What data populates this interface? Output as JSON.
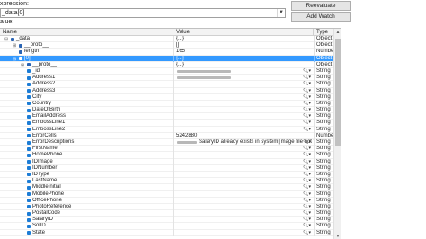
{
  "expression": {
    "label": "xpression:",
    "value": "_data[0]"
  },
  "buttons": {
    "reevaluate": "Reevaluate",
    "add_watch": "Add Watch"
  },
  "value_label": "alue:",
  "columns": {
    "name": "Name",
    "value": "Value",
    "type": "Type"
  },
  "rows": [
    {
      "name": "_data",
      "value": "{...}",
      "type": "Object, {",
      "level": 0,
      "toggle": "⊟",
      "icon": "bl",
      "selected": false,
      "magnifier": false,
      "redacted": false
    },
    {
      "name": "__proto__",
      "value": "[]",
      "type": "Object, [",
      "level": 1,
      "toggle": "⊞",
      "icon": "bl",
      "selected": false,
      "magnifier": false,
      "redacted": false
    },
    {
      "name": "length",
      "value": "165",
      "type": "Number",
      "level": 1,
      "toggle": "",
      "icon": "bl",
      "selected": false,
      "magnifier": false,
      "redacted": false
    },
    {
      "name": "[0]",
      "value": "{...}",
      "type": "Object",
      "level": 1,
      "toggle": "⊟",
      "icon": "bl",
      "selected": true,
      "magnifier": false,
      "redacted": false
    },
    {
      "name": "__proto__",
      "value": "{...}",
      "type": "Object",
      "level": 2,
      "toggle": "⊞",
      "icon": "bl",
      "selected": false,
      "magnifier": false,
      "redacted": false
    },
    {
      "name": "_id",
      "value": "",
      "type": "String",
      "level": 2,
      "toggle": "",
      "icon": "",
      "selected": false,
      "magnifier": true,
      "redacted": true
    },
    {
      "name": "Address1",
      "value": "",
      "type": "String",
      "level": 2,
      "toggle": "",
      "icon": "",
      "selected": false,
      "magnifier": true,
      "redacted": true
    },
    {
      "name": "Address2",
      "value": "",
      "type": "String",
      "level": 2,
      "toggle": "",
      "icon": "",
      "selected": false,
      "magnifier": true,
      "redacted": false
    },
    {
      "name": "Address3",
      "value": "",
      "type": "String",
      "level": 2,
      "toggle": "",
      "icon": "",
      "selected": false,
      "magnifier": true,
      "redacted": false
    },
    {
      "name": "City",
      "value": "",
      "type": "String",
      "level": 2,
      "toggle": "",
      "icon": "",
      "selected": false,
      "magnifier": true,
      "redacted": false
    },
    {
      "name": "Country",
      "value": "",
      "type": "String",
      "level": 2,
      "toggle": "",
      "icon": "",
      "selected": false,
      "magnifier": true,
      "redacted": false
    },
    {
      "name": "DateOfBirth",
      "value": "",
      "type": "String",
      "level": 2,
      "toggle": "",
      "icon": "",
      "selected": false,
      "magnifier": true,
      "redacted": false
    },
    {
      "name": "EmailAddress",
      "value": "",
      "type": "String",
      "level": 2,
      "toggle": "",
      "icon": "",
      "selected": false,
      "magnifier": true,
      "redacted": false
    },
    {
      "name": "EmbossLine1",
      "value": "",
      "type": "String",
      "level": 2,
      "toggle": "",
      "icon": "",
      "selected": false,
      "magnifier": true,
      "redacted": false
    },
    {
      "name": "EmbossLine2",
      "value": "",
      "type": "String",
      "level": 2,
      "toggle": "",
      "icon": "",
      "selected": false,
      "magnifier": true,
      "redacted": false
    },
    {
      "name": "ErrorCells",
      "value": "5242880",
      "type": "Number",
      "level": 2,
      "toggle": "",
      "icon": "",
      "selected": false,
      "magnifier": false,
      "redacted": false
    },
    {
      "name": "ErrorDescriptions",
      "value": "SalaryID already exists in system|Image file not found",
      "type": "String",
      "level": 2,
      "toggle": "",
      "icon": "",
      "selected": false,
      "magnifier": true,
      "redacted": true
    },
    {
      "name": "FirstName",
      "value": "",
      "type": "String",
      "level": 2,
      "toggle": "",
      "icon": "",
      "selected": false,
      "magnifier": true,
      "redacted": false
    },
    {
      "name": "HomePhone",
      "value": "",
      "type": "String",
      "level": 2,
      "toggle": "",
      "icon": "",
      "selected": false,
      "magnifier": true,
      "redacted": false
    },
    {
      "name": "IDImage",
      "value": "",
      "type": "String",
      "level": 2,
      "toggle": "",
      "icon": "",
      "selected": false,
      "magnifier": true,
      "redacted": false
    },
    {
      "name": "IDNumber",
      "value": "",
      "type": "String",
      "level": 2,
      "toggle": "",
      "icon": "",
      "selected": false,
      "magnifier": true,
      "redacted": false
    },
    {
      "name": "IDType",
      "value": "",
      "type": "String",
      "level": 2,
      "toggle": "",
      "icon": "",
      "selected": false,
      "magnifier": true,
      "redacted": false
    },
    {
      "name": "LastName",
      "value": "",
      "type": "String",
      "level": 2,
      "toggle": "",
      "icon": "",
      "selected": false,
      "magnifier": true,
      "redacted": false
    },
    {
      "name": "MiddleInitial",
      "value": "",
      "type": "String",
      "level": 2,
      "toggle": "",
      "icon": "",
      "selected": false,
      "magnifier": true,
      "redacted": false
    },
    {
      "name": "MobilePhone",
      "value": "",
      "type": "String",
      "level": 2,
      "toggle": "",
      "icon": "",
      "selected": false,
      "magnifier": true,
      "redacted": false
    },
    {
      "name": "OfficePhone",
      "value": "",
      "type": "String",
      "level": 2,
      "toggle": "",
      "icon": "",
      "selected": false,
      "magnifier": true,
      "redacted": false
    },
    {
      "name": "PhotoReference",
      "value": "",
      "type": "String",
      "level": 2,
      "toggle": "",
      "icon": "",
      "selected": false,
      "magnifier": true,
      "redacted": false
    },
    {
      "name": "PostalCode",
      "value": "",
      "type": "String",
      "level": 2,
      "toggle": "",
      "icon": "",
      "selected": false,
      "magnifier": true,
      "redacted": false
    },
    {
      "name": "SalaryID",
      "value": "",
      "type": "String",
      "level": 2,
      "toggle": "",
      "icon": "",
      "selected": false,
      "magnifier": true,
      "redacted": false
    },
    {
      "name": "SolID",
      "value": "",
      "type": "String",
      "level": 2,
      "toggle": "",
      "icon": "",
      "selected": false,
      "magnifier": true,
      "redacted": false
    },
    {
      "name": "State",
      "value": "",
      "type": "String",
      "level": 2,
      "toggle": "",
      "icon": "",
      "selected": false,
      "magnifier": true,
      "redacted": false
    }
  ]
}
